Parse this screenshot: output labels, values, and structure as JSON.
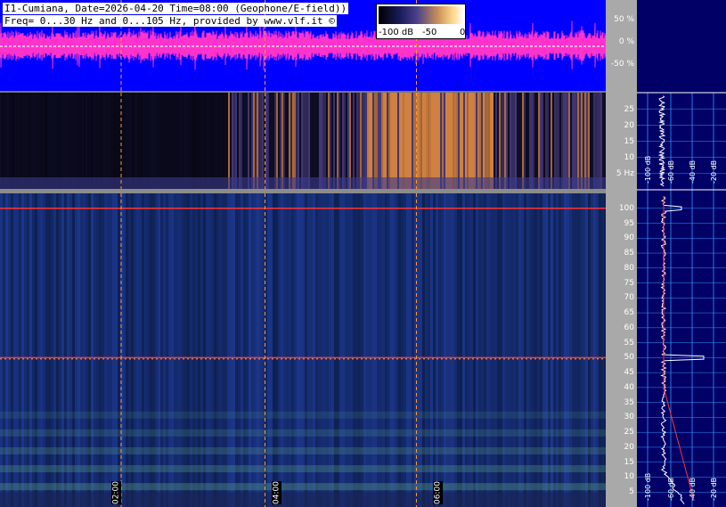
{
  "header": {
    "line1": "I1-Cumiana, Date=2026-04-20 Time=08:00 (Geophone/E-field))",
    "line2": "Freq= 0...30 Hz and 0...105 Hz, provided by www.vlf.it ©"
  },
  "colorbar": {
    "labels": [
      "-100 dB",
      "-50",
      "0"
    ]
  },
  "waveform_axis": {
    "ticks": [
      "50 %",
      "0 %",
      "-50 %"
    ]
  },
  "lf_axis": {
    "ticks": [
      "25",
      "20",
      "15",
      "10",
      "5 Hz"
    ]
  },
  "main_axis": {
    "ticks": [
      "100",
      "95",
      "90",
      "85",
      "80",
      "75",
      "70",
      "65",
      "60",
      "55",
      "50",
      "45",
      "40",
      "35",
      "30",
      "25",
      "20",
      "15",
      "10",
      "5"
    ]
  },
  "time_axis": {
    "labels": [
      "02:00",
      "04:00",
      "06:00"
    ]
  },
  "side_axis_upper": {
    "labels": [
      "-100 dB",
      "-60 dB",
      "-40 dB",
      "-20 dB"
    ]
  },
  "side_axis_lower": {
    "labels": [
      "-100 dB",
      "-60 dB",
      "-40 dB",
      "-20 dB"
    ]
  },
  "colors": {
    "waveform_bg": "#0000ff",
    "waveform_trace": "#ff33cc",
    "marker_line": "#ff9933",
    "hum_line": "#ff3333",
    "side_bg": "#000066",
    "side_grid": "#3399ff"
  },
  "chart_data": [
    {
      "type": "area",
      "title": "",
      "xlabel": "",
      "ylabel": "",
      "ylim": [
        -50,
        50
      ],
      "yticks": [
        "50 %",
        "0 %",
        "-50 %"
      ],
      "x_unit": "hours",
      "xlim": [
        0,
        8
      ],
      "series": [
        {
          "values": [
            0
          ]
        }
      ]
    },
    {
      "type": "heatmap",
      "title": "",
      "xlabel": "",
      "ylabel": "",
      "ylim": [
        0,
        30
      ],
      "yticks": [
        5,
        10,
        15,
        20,
        25
      ],
      "xlim": [
        0,
        8
      ],
      "x_unit": "hours"
    },
    {
      "type": "heatmap",
      "title": "",
      "xlabel": "",
      "ylabel": "",
      "ylim": [
        0,
        105
      ],
      "yticks": [
        5,
        10,
        15,
        20,
        25,
        30,
        35,
        40,
        45,
        50,
        55,
        60,
        65,
        70,
        75,
        80,
        85,
        90,
        95,
        100
      ],
      "xlim": [
        0,
        8
      ],
      "x_unit": "hours",
      "xticks": [
        "02:00",
        "04:00",
        "06:00"
      ],
      "annotations": [
        {
          "type": "hline",
          "y": 50
        },
        {
          "type": "hline",
          "y": 100
        }
      ]
    },
    {
      "type": "line",
      "title": "",
      "xlabel": "",
      "ylabel": "",
      "xticks": [
        "-100 dB",
        "-60 dB",
        "-40 dB",
        "-20 dB"
      ],
      "ylim": [
        0,
        105
      ],
      "peaks": [
        {
          "y": 50
        },
        {
          "y": 100
        }
      ]
    }
  ]
}
